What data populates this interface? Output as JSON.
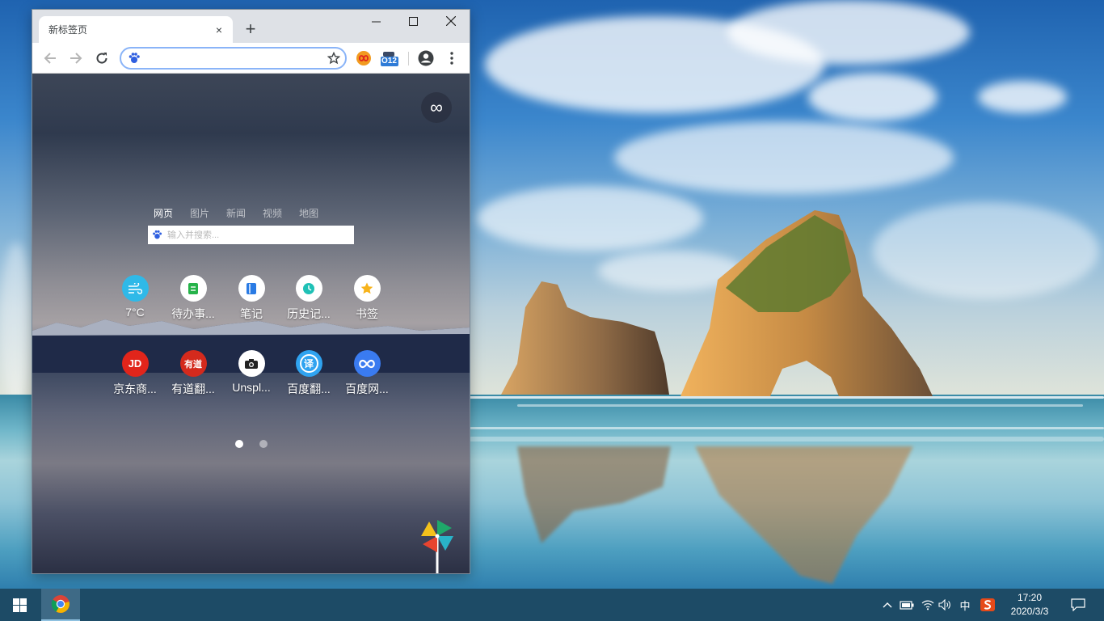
{
  "browser": {
    "tab_title": "新标签页",
    "tab_close": "×",
    "new_tab": "+",
    "omnibox_value": "",
    "extension_badge": "O12"
  },
  "newtab_page": {
    "search_tabs": [
      "网页",
      "图片",
      "新闻",
      "视频",
      "地图"
    ],
    "search_placeholder": "输入并搜索...",
    "shortcuts_row1": [
      {
        "label": "7°C",
        "icon": "weather-wind-icon",
        "color": "#2fb9e8"
      },
      {
        "label": "待办事...",
        "icon": "todo-icon",
        "color": "#ffffff"
      },
      {
        "label": "笔记",
        "icon": "notes-icon",
        "color": "#ffffff"
      },
      {
        "label": "历史记...",
        "icon": "history-clock-icon",
        "color": "#ffffff"
      },
      {
        "label": "书签",
        "icon": "bookmark-star-icon",
        "color": "#ffffff"
      }
    ],
    "shortcuts_row2": [
      {
        "label": "京东商...",
        "icon": "jd-logo-icon",
        "color": "#e1251b",
        "glyph": "JD"
      },
      {
        "label": "有道翻...",
        "icon": "youdao-logo-icon",
        "color": "#d42a1d",
        "glyph": "有道"
      },
      {
        "label": "Unspl...",
        "icon": "camera-icon",
        "color": "#ffffff"
      },
      {
        "label": "百度翻...",
        "icon": "baidu-translate-icon",
        "color": "#2fa3f0",
        "glyph": "译"
      },
      {
        "label": "百度网...",
        "icon": "baidu-netdisk-icon",
        "color": "#3a7bf0"
      }
    ],
    "page_count": 2,
    "current_page": 1
  },
  "taskbar": {
    "ime": "中",
    "time": "17:20",
    "date": "2020/3/3"
  }
}
